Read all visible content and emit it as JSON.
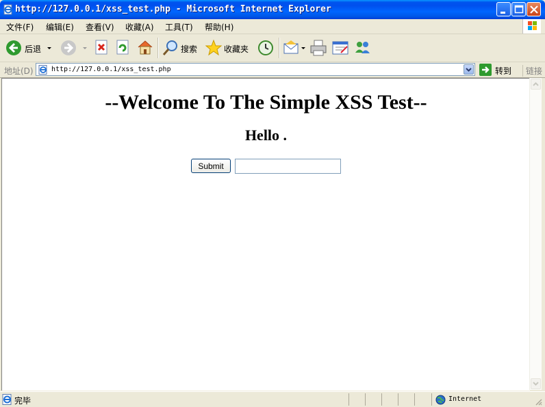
{
  "window": {
    "title": "http://127.0.0.1/xss_test.php - Microsoft Internet Explorer"
  },
  "menubar": {
    "items": [
      {
        "label": "文件(F)"
      },
      {
        "label": "编辑(E)"
      },
      {
        "label": "查看(V)"
      },
      {
        "label": "收藏(A)"
      },
      {
        "label": "工具(T)"
      },
      {
        "label": "帮助(H)"
      }
    ]
  },
  "toolbar": {
    "back_label": "后退",
    "search_label": "搜索",
    "favorites_label": "收藏夹"
  },
  "addressbar": {
    "label": "地址(D)",
    "url": "http://127.0.0.1/xss_test.php",
    "go_label": "转到",
    "links_label": "链接"
  },
  "page": {
    "heading": "--Welcome To The Simple XSS Test--",
    "greeting": "Hello .",
    "submit_label": "Submit",
    "input_value": ""
  },
  "statusbar": {
    "status_text": "完毕",
    "zone_text": "Internet"
  },
  "colors": {
    "titlebar": "#0054e3",
    "chrome": "#ece9d8",
    "content_bg": "#ffffff"
  },
  "icons": [
    "ie-page-icon",
    "minimize-icon",
    "maximize-icon",
    "close-icon",
    "windows-flag-icon",
    "back-icon",
    "forward-icon",
    "stop-icon",
    "refresh-icon",
    "home-icon",
    "search-icon",
    "favorites-star-icon",
    "history-icon",
    "mail-icon",
    "print-icon",
    "edit-icon",
    "messenger-icon",
    "go-arrow-icon",
    "globe-icon"
  ]
}
